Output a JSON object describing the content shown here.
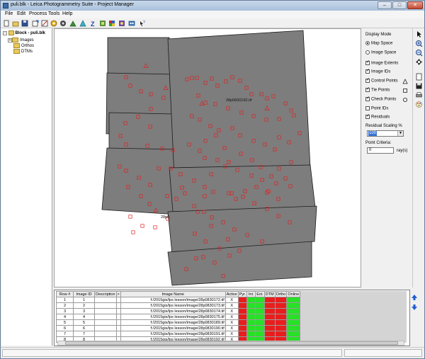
{
  "window": {
    "title": "puli.blk - Leica Photogrammetry Suite - Project Manager",
    "minimize": "–",
    "maximize": "□",
    "close": "✕"
  },
  "menu": [
    "File",
    "Edit",
    "Process",
    "Tools",
    "Help"
  ],
  "toolbar_icons": [
    "new-icon",
    "open-icon",
    "save-icon",
    "add-frame-icon",
    "frame-editor-icon",
    "point-measure-icon",
    "triangulation-icon",
    "z-icon",
    "ortho-icon",
    "mosaic-icon",
    "feature-icon",
    "stereo-icon",
    "help-icon"
  ],
  "tree": {
    "root": "Block - puli.blk",
    "children": [
      "Images",
      "Orthos",
      "DTMs"
    ]
  },
  "canvas": {
    "labels": [
      {
        "text": "28p0830192.tif"
      },
      {
        "text": "28p0"
      }
    ]
  },
  "side_panel": {
    "display_mode_label": "Display Mode",
    "map_space": "Map Space",
    "image_space": "Image Space",
    "image_extents": "Image Extents",
    "image_ids": "Image IDs",
    "control_points": "Control Points",
    "tie_points": "Tie Points",
    "check_points": "Check Points",
    "point_ids": "Point IDs",
    "residuals": "Residuals",
    "residual_scaling_label": "Residual Scaling %",
    "residual_scaling_value": "100",
    "point_criteria_label": "Point Criteria:",
    "point_criteria_value": "0",
    "point_criteria_unit": "ray(s)"
  },
  "table": {
    "headers": [
      "Row #",
      "Image ID",
      "Description",
      ">",
      "Image Name",
      "Active",
      "Pyr.",
      "Int.",
      "Ext.",
      "DTM",
      "Ortho",
      "Online"
    ],
    "rows": [
      {
        "row": "1",
        "id": "1",
        "name": "f:/2015gis/lps lesson/image/28p0830172.tif",
        "active": "X"
      },
      {
        "row": "2",
        "id": "2",
        "name": "f:/2015gis/lps lesson/image/28p0830173.tif",
        "active": "X"
      },
      {
        "row": "3",
        "id": "3",
        "name": "f:/2015gis/lps lesson/image/28p0830174.tif",
        "active": "X"
      },
      {
        "row": "4",
        "id": "4",
        "name": "f:/2015gis/lps lesson/image/28p0830175.tif",
        "active": "X"
      },
      {
        "row": "5",
        "id": "5",
        "name": "f:/2015gis/lps lesson/image/28p0830189.tif",
        "active": "X"
      },
      {
        "row": "6",
        "id": "6",
        "name": "f:/2015gis/lps lesson/image/28p0830190.tif",
        "active": "X"
      },
      {
        "row": "7",
        "id": "7",
        "name": "f:/2015gis/lps lesson/image/28p0830191.tif",
        "active": "X"
      },
      {
        "row": "8",
        "id": "8",
        "name": "f:/2015gis/lps lesson/image/28p0830192.tif",
        "active": "X"
      }
    ],
    "status_colors": {
      "red": "#e81e1e",
      "green": "#28e028"
    }
  },
  "colors": {
    "image_fill": "#7d7d7d",
    "point_color": "#e02020",
    "title_bar": "#b9cde3"
  }
}
